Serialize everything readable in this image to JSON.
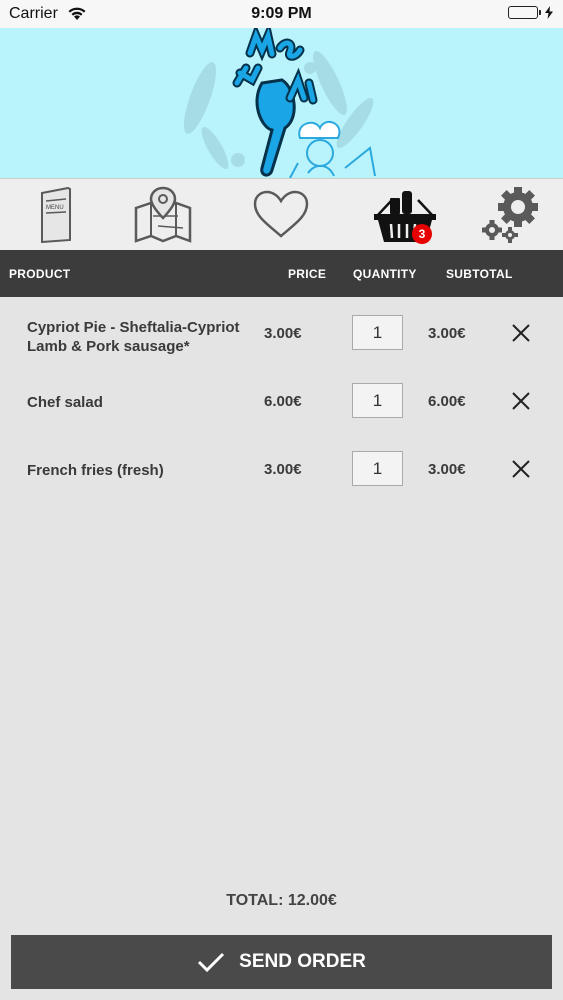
{
  "status_bar": {
    "carrier": "Carrier",
    "time": "9:09 PM"
  },
  "tabs": [
    {
      "icon": "menu-icon",
      "label": "MENU"
    },
    {
      "icon": "map-icon"
    },
    {
      "icon": "heart-icon"
    },
    {
      "icon": "basket-icon",
      "badge": "3"
    },
    {
      "icon": "gear-icon"
    }
  ],
  "table_header": {
    "product": "PRODUCT",
    "price": "PRICE",
    "quantity": "QUANTITY",
    "subtotal": "SUBTOTAL"
  },
  "items": [
    {
      "name": "Cypriot Pie - Sheftalia-Cypriot Lamb & Pork sausage*",
      "price": "3.00€",
      "quantity": "1",
      "subtotal": "3.00€"
    },
    {
      "name": "Chef salad",
      "price": "6.00€",
      "quantity": "1",
      "subtotal": "6.00€"
    },
    {
      "name": "French fries (fresh)",
      "price": "3.00€",
      "quantity": "1",
      "subtotal": "3.00€"
    }
  ],
  "total": "TOTAL: 12.00€",
  "send_button": {
    "label": "SEND ORDER"
  },
  "colors": {
    "banner": "#b9f3fb",
    "header": "#3c3c3c",
    "badge": "#e60000",
    "button": "#4a4a4a"
  }
}
